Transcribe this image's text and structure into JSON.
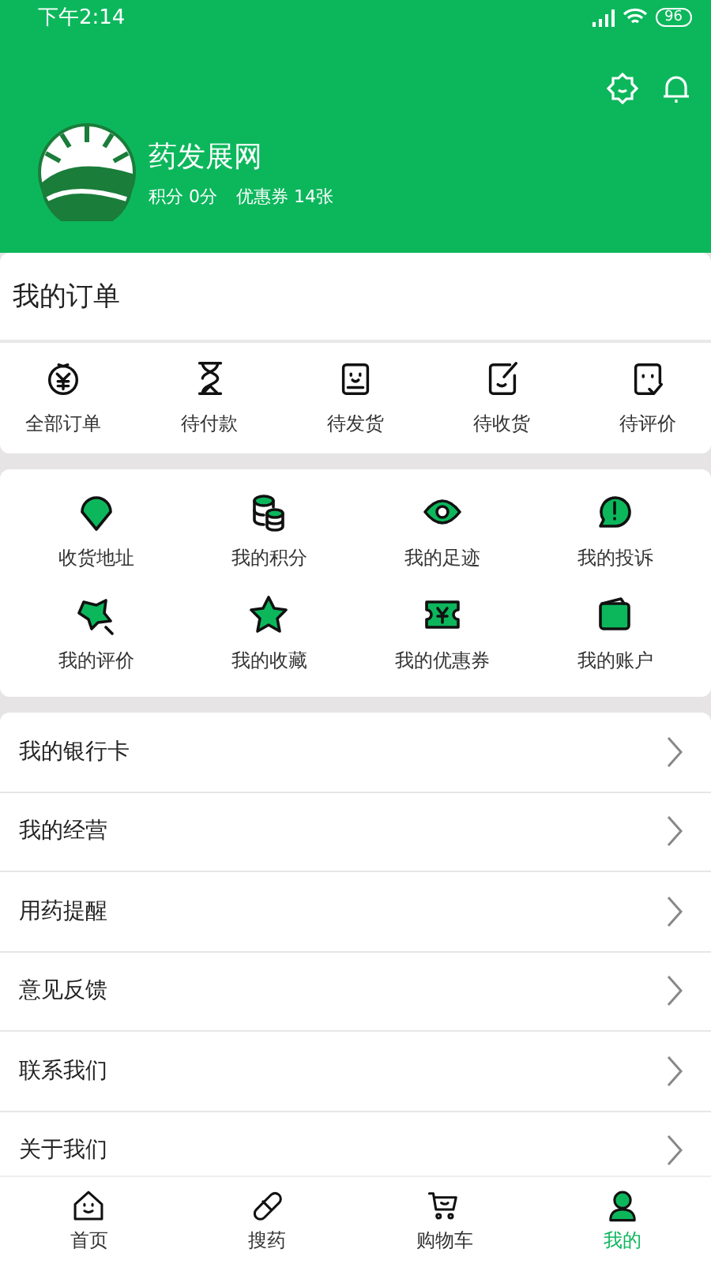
{
  "status_bar": {
    "time": "下午2:14",
    "battery": "96"
  },
  "profile": {
    "name": "药发展网",
    "points": "积分 0分",
    "coupons": "优惠券 14张"
  },
  "orders": {
    "title": "我的订单",
    "items": [
      {
        "label": "全部订单",
        "kind": "yen"
      },
      {
        "label": "待付款",
        "kind": "hourglass"
      },
      {
        "label": "待发货",
        "kind": "box"
      },
      {
        "label": "待收货",
        "kind": "receive"
      },
      {
        "label": "待评价",
        "kind": "review"
      }
    ]
  },
  "services": [
    {
      "label": "收货地址",
      "kind": "pin"
    },
    {
      "label": "我的积分",
      "kind": "coins"
    },
    {
      "label": "我的足迹",
      "kind": "eye"
    },
    {
      "label": "我的投诉",
      "kind": "alert"
    },
    {
      "label": "我的评价",
      "kind": "starwand"
    },
    {
      "label": "我的收藏",
      "kind": "star"
    },
    {
      "label": "我的优惠券",
      "kind": "ticket"
    },
    {
      "label": "我的账户",
      "kind": "wallet"
    }
  ],
  "menu": [
    "我的银行卡",
    "我的经营",
    "用药提醒",
    "意见反馈",
    "联系我们",
    "关于我们"
  ],
  "tabs": [
    {
      "label": "首页",
      "kind": "home",
      "selected": false
    },
    {
      "label": "搜药",
      "kind": "pill",
      "selected": false
    },
    {
      "label": "购物车",
      "kind": "cart",
      "selected": false
    },
    {
      "label": "我的",
      "kind": "person",
      "selected": true
    }
  ]
}
